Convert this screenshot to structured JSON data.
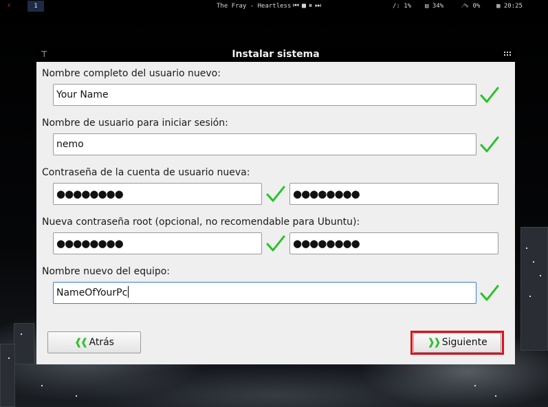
{
  "topbar": {
    "tag": "1",
    "now_playing": "The Fray - Heartless",
    "media_controls": "⏮■⏸⏭",
    "cpu_label": "/: 1%",
    "mem_label": "34%",
    "net_label": "0%",
    "clock": "20:25"
  },
  "window": {
    "title": "Instalar sistema"
  },
  "form": {
    "full_name_label": "Nombre completo del usuario nuevo:",
    "full_name_value": "Your Name",
    "username_label": "Nombre de usuario para iniciar sesión:",
    "username_value": "nemo",
    "password_label": "Contraseña de la cuenta de usuario nueva:",
    "password_value": "●●●●●●●●",
    "password_confirm_value": "●●●●●●●●",
    "root_label": "Nueva contraseña root (opcional, no recomendable para Ubuntu):",
    "root_value": "●●●●●●●●",
    "root_confirm_value": "●●●●●●●●",
    "hostname_label": "Nombre nuevo del equipo:",
    "hostname_value": "NameOfYourPc"
  },
  "buttons": {
    "back_arrows": "❰❰",
    "back_label": "Atrás",
    "next_arrows": "❱❱",
    "next_label": "Siguiente"
  },
  "colors": {
    "check": "#22c422",
    "highlight": "#e0101a",
    "tag_bg": "#1e2a44"
  }
}
